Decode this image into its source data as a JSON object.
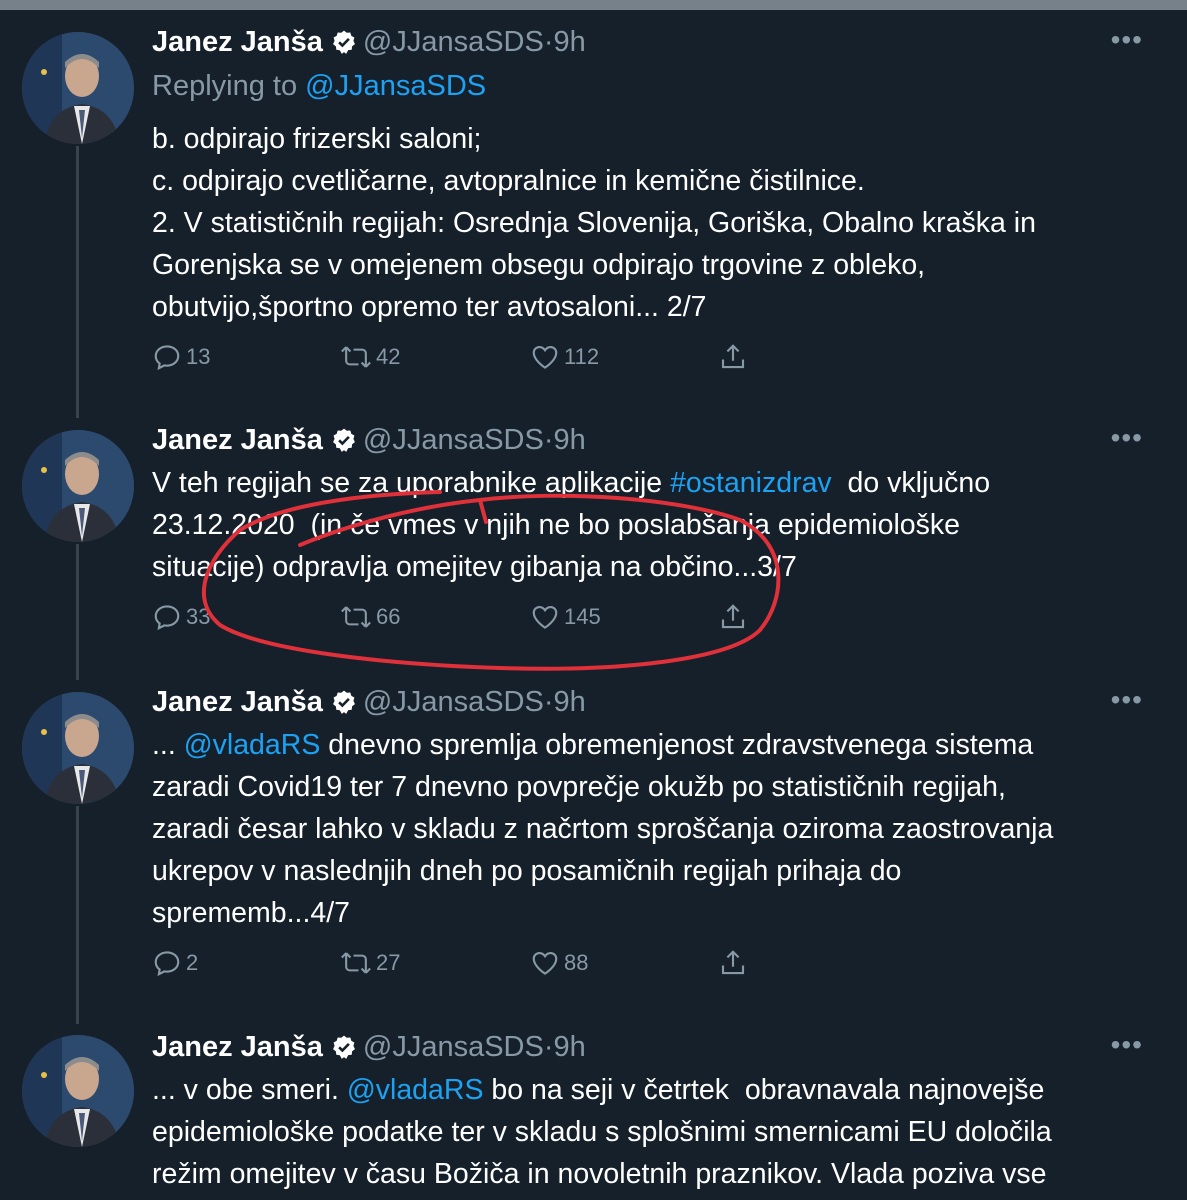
{
  "tweets": [
    {
      "name": "Janez Janša",
      "handle": "@JJansaSDS",
      "sep": "·",
      "time": "9h",
      "more": "•••",
      "replying_prefix": "Replying to ",
      "replying_handle": "@JJansaSDS",
      "lines": [
        "b. odpirajo frizerski saloni;",
        "c. odpirajo cvetličarne, avtopralnice in kemične čistilnice.",
        "2. V statističnih regijah: Osrednja Slovenija, Goriška, Obalno kraška in",
        "Gorenjska se v omejenem obsegu odpirajo trgovine z obleko,",
        "obutvijo,športno opremo ter avtosaloni... 2/7"
      ],
      "replies": "13",
      "retweets": "42",
      "likes": "112"
    },
    {
      "name": "Janez Janša",
      "handle": "@JJansaSDS",
      "sep": "·",
      "time": "9h",
      "more": "•••",
      "line1_pre": "V teh regijah se za uporabnike aplikacije ",
      "line1_tag": "#ostanizdrav",
      "line1_post": "  do vključno",
      "line2": "23.12.2020  (in če vmes v njih ne bo poslabšanja epidemiološke",
      "line3": "situacije) odpravlja omejitev gibanja na občino...3/7",
      "replies": "33",
      "retweets": "66",
      "likes": "145"
    },
    {
      "name": "Janez Janša",
      "handle": "@JJansaSDS",
      "sep": "·",
      "time": "9h",
      "more": "•••",
      "line1_pre": "... ",
      "line1_mention": "@vladaRS",
      "line1_post": " dnevno spremlja obremenjenost zdravstvenega sistema",
      "lines_rest": [
        "zaradi Covid19 ter 7 dnevno povprečje okužb po statističnih regijah,",
        "zaradi česar lahko v skladu z načrtom sproščanja oziroma zaostrovanja",
        "ukrepov v naslednjih dneh po posamičnih regijah prihaja do",
        "sprememb...4/7"
      ],
      "replies": "2",
      "retweets": "27",
      "likes": "88"
    },
    {
      "name": "Janez Janša",
      "handle": "@JJansaSDS",
      "sep": "·",
      "time": "9h",
      "more": "•••",
      "line1_pre": "... v obe smeri. ",
      "line1_mention": "@vladaRS",
      "line1_post": " bo na seji v četrtek  obravnavala najnovejše",
      "lines_rest": [
        "epidemiološke podatke ter v skladu s splošnimi smernicami EU določila",
        "režim omejitev v času Božiča in novoletnih praznikov. Vlada poziva vse"
      ]
    }
  ],
  "colors": {
    "background": "#15202b",
    "text": "#ffffff",
    "muted": "#8899a6",
    "link": "#1da1f2",
    "thread_line": "#38444d",
    "annotation": "#e0303a"
  }
}
